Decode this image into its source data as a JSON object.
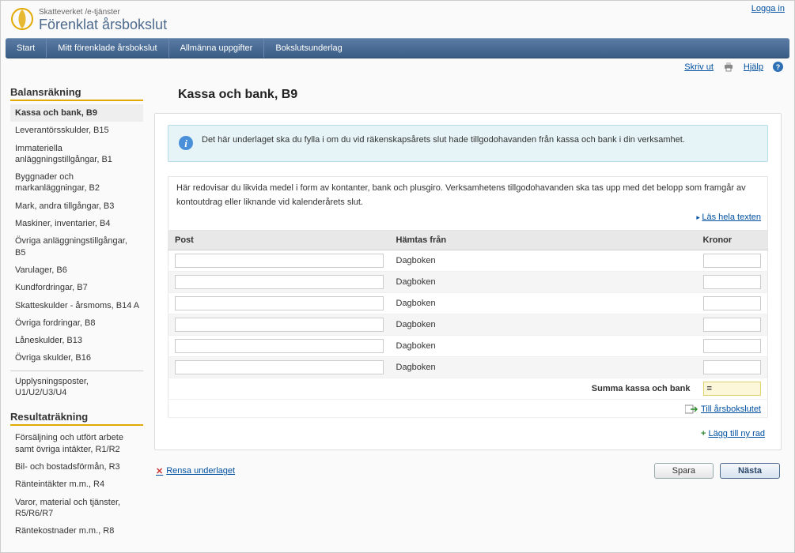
{
  "header": {
    "line1": "Skatteverket /e-tjänster",
    "line2": "Förenklat årsbokslut",
    "login": "Logga in"
  },
  "nav": {
    "items": [
      "Start",
      "Mitt förenklade årsbokslut",
      "Allmänna uppgifter",
      "Bokslutsunderlag"
    ]
  },
  "subbar": {
    "print": "Skriv ut",
    "help": "Hjälp"
  },
  "sidebar": {
    "balans_heading": "Balansräkning",
    "balans_items": [
      {
        "label": "Kassa och bank, B9",
        "active": true
      },
      {
        "label": "Leverantörsskulder, B15"
      },
      {
        "label": "Immateriella anläggningstillgångar, B1"
      },
      {
        "label": "Byggnader och markanläggningar, B2"
      },
      {
        "label": "Mark, andra tillgångar, B3"
      },
      {
        "label": "Maskiner, inventarier, B4"
      },
      {
        "label": "Övriga anläggningstillgångar, B5"
      },
      {
        "label": "Varulager, B6"
      },
      {
        "label": "Kundfordringar, B7"
      },
      {
        "label": "Skatteskulder - årsmoms, B14 A"
      },
      {
        "label": "Övriga fordringar, B8"
      },
      {
        "label": "Låneskulder, B13"
      },
      {
        "label": "Övriga skulder, B16"
      },
      {
        "label": "Upplysningsposter, U1/U2/U3/U4",
        "sep": true
      }
    ],
    "resultat_heading": "Resultaträkning",
    "resultat_items": [
      {
        "label": "Försäljning och utfört arbete samt övriga intäkter, R1/R2"
      },
      {
        "label": "Bil- och bostadsförmån, R3"
      },
      {
        "label": "Ränteintäkter m.m., R4"
      },
      {
        "label": "Varor, material och tjänster, R5/R6/R7"
      },
      {
        "label": "Räntekostnader m.m., R8"
      }
    ]
  },
  "main": {
    "title": "Kassa och bank, B9",
    "info": "Det här underlaget ska du fylla i om du vid räkenskapsårets slut hade tillgodohavanden från kassa och bank i din verksamhet.",
    "desc": "Här redovisar du likvida medel i form av kontanter, bank och plusgiro. Verksamhetens tillgodohavanden ska tas upp med det belopp som framgår av kontoutdrag eller liknande vid kalenderårets slut.",
    "read_more": "Läs hela texten",
    "table": {
      "col_post": "Post",
      "col_from": "Hämtas från",
      "col_kr": "Kronor",
      "rows": [
        {
          "post": "",
          "from": "Dagboken",
          "kr": ""
        },
        {
          "post": "",
          "from": "Dagboken",
          "kr": ""
        },
        {
          "post": "",
          "from": "Dagboken",
          "kr": ""
        },
        {
          "post": "",
          "from": "Dagboken",
          "kr": ""
        },
        {
          "post": "",
          "from": "Dagboken",
          "kr": ""
        },
        {
          "post": "",
          "from": "Dagboken",
          "kr": ""
        }
      ],
      "sum_label": "Summa kassa och bank",
      "sum_value": "=",
      "goto_label": "Till årsbokslutet"
    },
    "add_row": "Lägg till ny rad",
    "clear": "Rensa underlaget",
    "save": "Spara",
    "next": "Nästa"
  }
}
